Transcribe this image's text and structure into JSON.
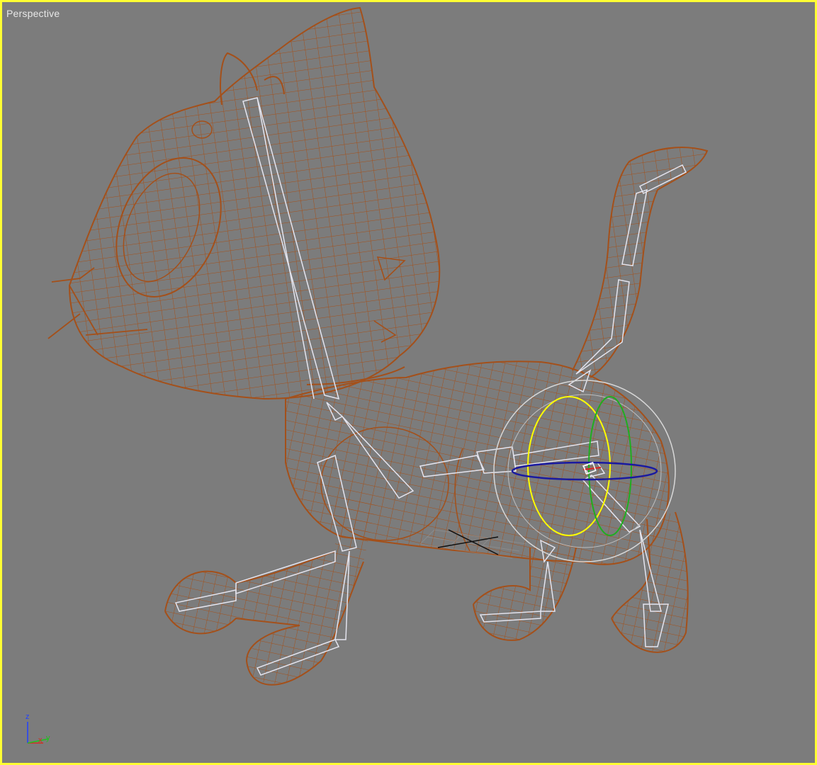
{
  "viewport": {
    "label": "Perspective",
    "active_border_color": "#ffff33",
    "background_color": "#7c7c7c"
  },
  "model": {
    "wire_color": "#a4501a",
    "bone_color": "#e4e4ee",
    "object": "cartoon-cat-wireframe"
  },
  "gizmo": {
    "x_ring_color": "#ffff00",
    "y_ring_color": "#1fae1f",
    "z_ring_color": "#1a1aa0",
    "outer_ring_color": "#d8d8d8"
  },
  "axis_tripod": {
    "z": "z",
    "x": "x",
    "y": "y",
    "x_color": "#d03020",
    "y_color": "#20c020",
    "z_color": "#2040ff"
  }
}
